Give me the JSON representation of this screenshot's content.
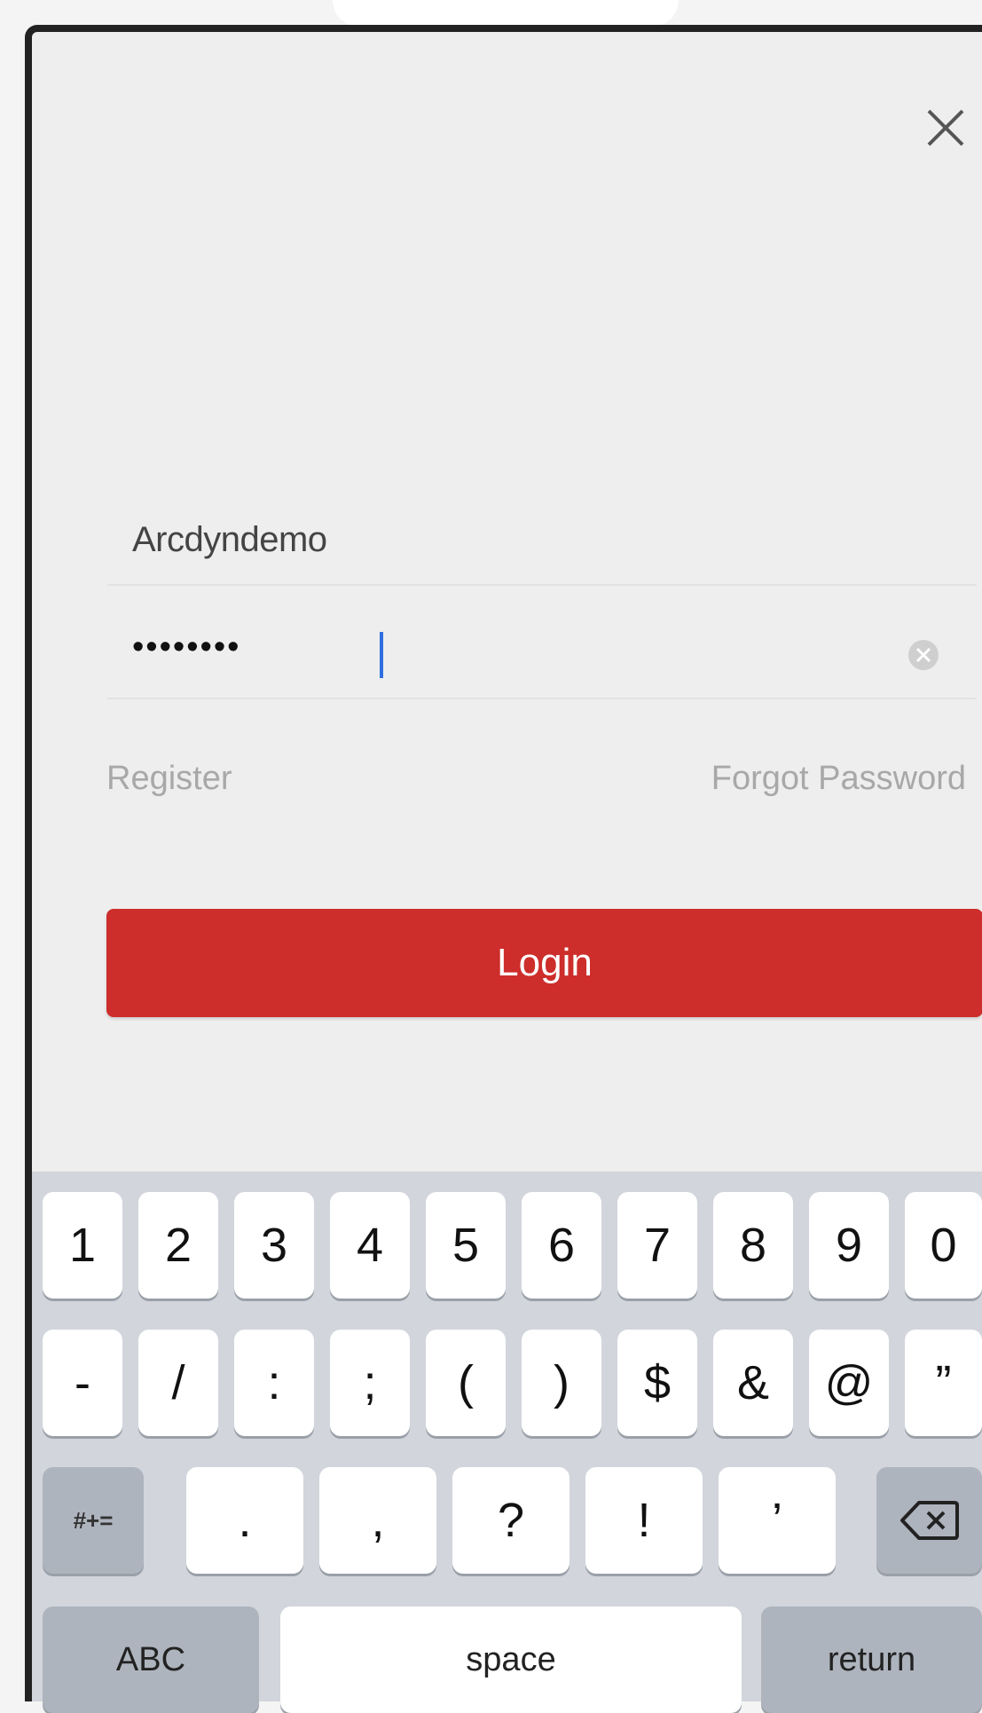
{
  "modal": {
    "close_icon": "close-icon",
    "username_value": "Arcdyndemo",
    "password_mask": "••••••••",
    "clear_icon": "clear-circle-icon",
    "register_label": "Register",
    "forgot_label": "Forgot Password",
    "login_label": "Login",
    "accent_color": "#cd2e2b"
  },
  "keyboard": {
    "row1": [
      "1",
      "2",
      "3",
      "4",
      "5",
      "6",
      "7",
      "8",
      "9",
      "0"
    ],
    "row2": [
      "-",
      "/",
      ":",
      ";",
      "(",
      ")",
      "$",
      "&",
      "@",
      "”"
    ],
    "row3": [
      ".",
      ",",
      "?",
      "!",
      "’"
    ],
    "more_symbols_label": "#+=",
    "backspace_icon": "backspace-icon",
    "abc_label": "ABC",
    "space_label": "space",
    "return_label": "return"
  }
}
